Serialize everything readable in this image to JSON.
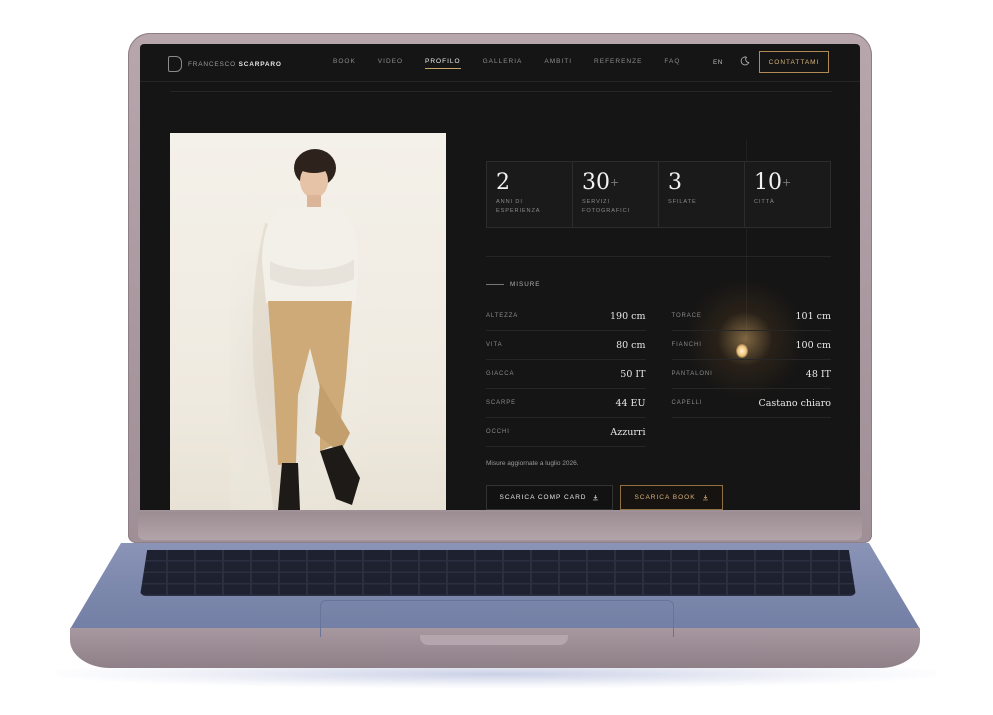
{
  "header": {
    "logo_first": "FRANCESCO",
    "logo_last": "SCARPARO",
    "nav": [
      {
        "label": "BOOK",
        "active": false
      },
      {
        "label": "VIDEO",
        "active": false
      },
      {
        "label": "PROFILO",
        "active": true
      },
      {
        "label": "GALLERIA",
        "active": false
      },
      {
        "label": "AMBITI",
        "active": false
      },
      {
        "label": "REFERENZE",
        "active": false
      },
      {
        "label": "FAQ",
        "active": false
      }
    ],
    "lang": "EN",
    "theme_icon": "moon-icon",
    "cta": "CONTATTAMI"
  },
  "stats": [
    {
      "value": "2",
      "plus": "",
      "label": "ANNI DI\nESPERIENZA"
    },
    {
      "value": "30",
      "plus": "+",
      "label": "SERVIZI\nFOTOGRAFICI"
    },
    {
      "value": "3",
      "plus": "",
      "label": "SFILATE"
    },
    {
      "value": "10",
      "plus": "+",
      "label": "CITTÀ"
    }
  ],
  "measures": {
    "title": "MISURE",
    "rows": [
      [
        {
          "label": "ALTEZZA",
          "value": "190 cm"
        },
        {
          "label": "TORACE",
          "value": "101 cm"
        }
      ],
      [
        {
          "label": "VITA",
          "value": "80 cm"
        },
        {
          "label": "FIANCHI",
          "value": "100 cm"
        }
      ],
      [
        {
          "label": "GIACCA",
          "value": "50 IT"
        },
        {
          "label": "PANTALONI",
          "value": "48 IT"
        }
      ],
      [
        {
          "label": "SCARPE",
          "value": "44 EU"
        },
        {
          "label": "CAPELLI",
          "value": "Castano chiaro"
        }
      ],
      [
        {
          "label": "OCCHI",
          "value": "Azzurri"
        }
      ]
    ],
    "note": "Misure aggiornate a luglio 2026."
  },
  "buttons": {
    "comp_card": "SCARICA COMP CARD",
    "book": "SCARICA BOOK"
  },
  "colors": {
    "accent": "#c9a56a",
    "background": "#151515"
  }
}
